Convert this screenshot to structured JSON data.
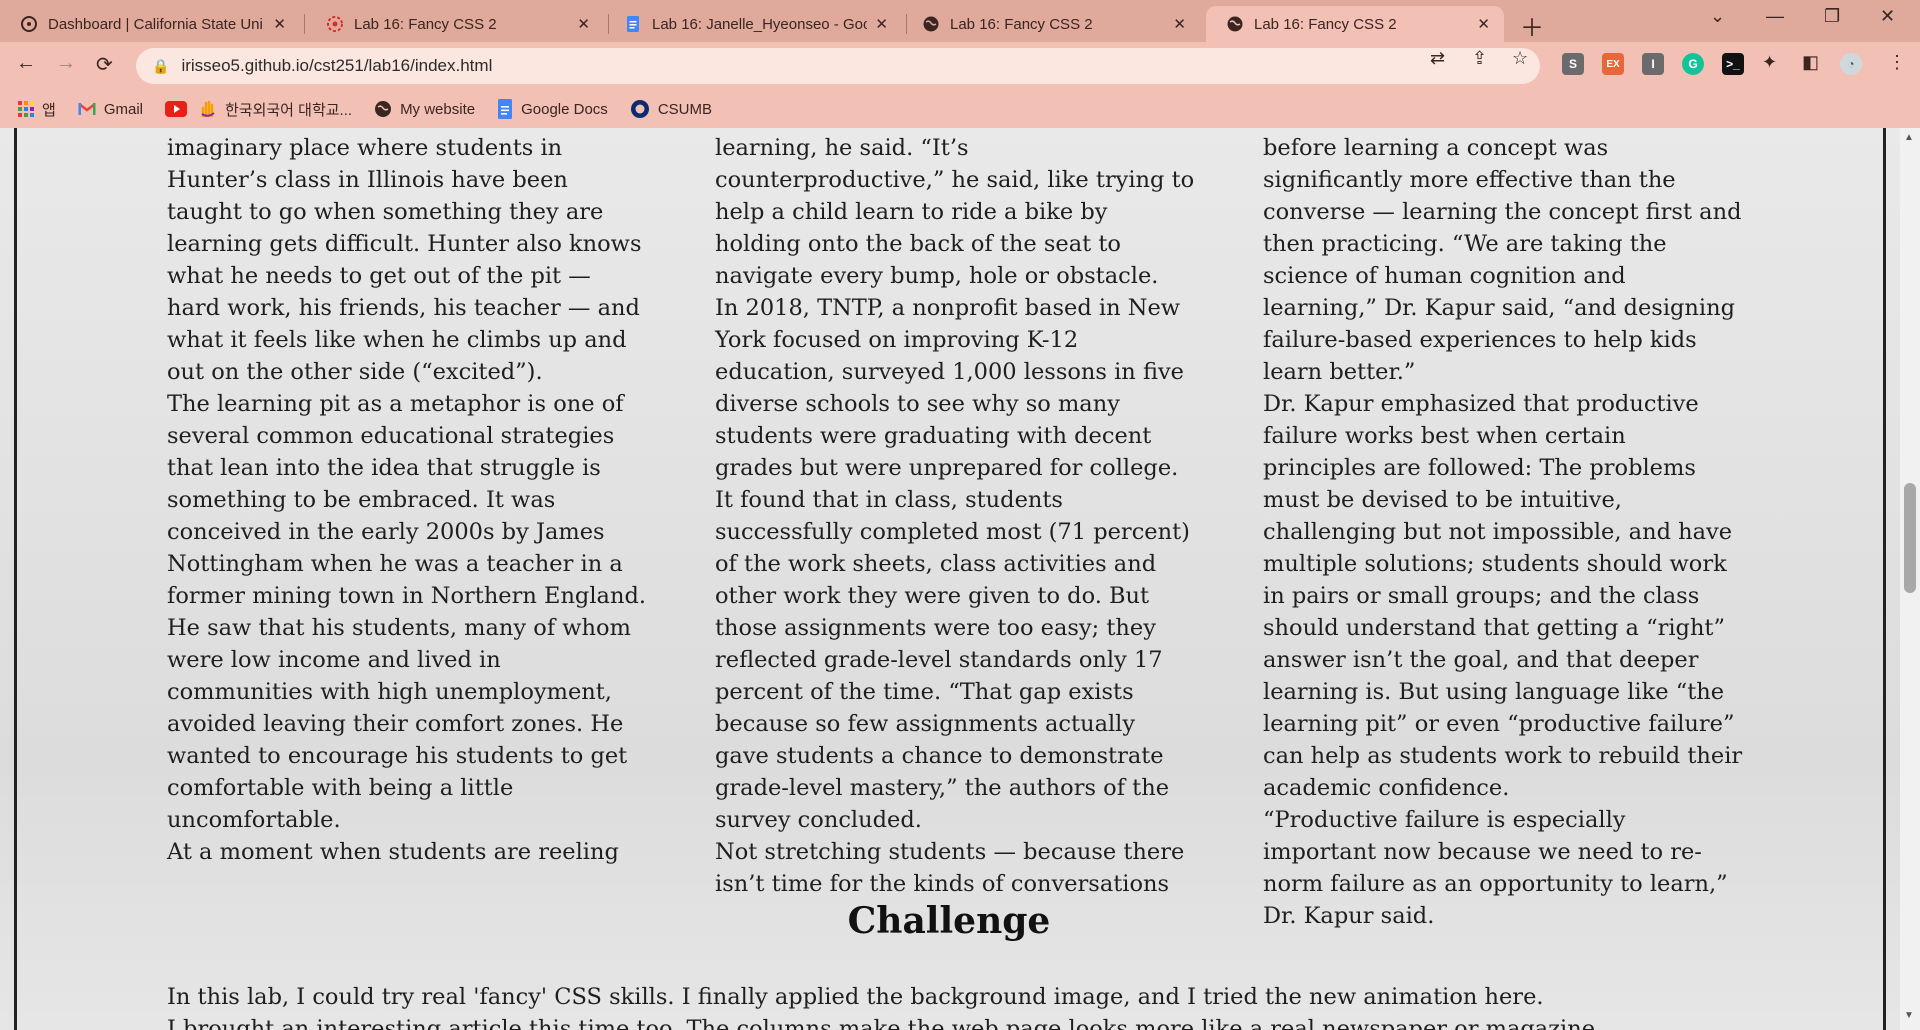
{
  "tabs": [
    {
      "title": "Dashboard | California State Uni",
      "icon": "canvas-icon"
    },
    {
      "title": "Lab 16: Fancy CSS 2",
      "icon": "red-flower-icon"
    },
    {
      "title": "Lab 16: Janelle_Hyeonseo - Goo",
      "icon": "google-docs-icon"
    },
    {
      "title": "Lab 16: Fancy CSS 2",
      "icon": "globe-icon"
    },
    {
      "title": "Lab 16: Fancy CSS 2",
      "icon": "globe-icon",
      "active": true
    }
  ],
  "address": {
    "url": "irisseo5.github.io/cst251/lab16/index.html"
  },
  "bookmarks": {
    "apps": "앱",
    "gmail": "Gmail",
    "hufs": "한국외국어 대학교...",
    "my_website": "My website",
    "google_docs": "Google Docs",
    "csumb": "CSUMB"
  },
  "extensions": {
    "s": "S",
    "ex": "EX",
    "i": "I"
  },
  "article": {
    "col1": [
      "the bottom of the learning pit, an imaginary place where students in Hunter’s class in Illinois have been taught to go when something they are learning gets difficult. Hunter also knows what he needs to get out of the pit — hard work, his friends, his teacher — and what it feels like when he climbs up and out on the other side (“excited”).",
      "The learning pit as a metaphor is one of several common educational strategies that lean into the idea that struggle is something to be embraced. It was conceived in the early 2000s by James Nottingham when he was a teacher in a former mining town in Northern England. He saw that his students, many of whom were low income and lived in communities with high unemployment, avoided leaving their comfort zones. He wanted to encourage his students to get comfortable with being a little uncomfortable.",
      "At a moment when students are reeling"
    ],
    "col2": [
      "to stretch enough to deepen their learning, he said. “It’s counterproductive,” he said, like trying to help a child learn to ride a bike by holding onto the back of the seat to navigate every bump, hole or obstacle.",
      "In 2018, TNTP, a nonprofit based in New York focused on improving K-12 education, surveyed 1,000 lessons in five diverse schools to see why so many students were graduating with decent grades but were unprepared for college. It found that in class, students successfully completed most (71 percent) of the work sheets, class activities and other work they were given to do. But those assignments were too easy; they reflected grade-level standards only 17 percent of the time. “That gap exists because so few assignments actually gave students a chance to demonstrate grade-level mastery,” the authors of the survey concluded.",
      "Not stretching students — because there isn’t time for the kinds of conversations"
    ],
    "col3": [
      "struggle first. Problem-solving practice before learning a concept was significantly more effective than the converse — learning the concept first and then practicing. “We are taking the science of human cognition and learning,” Dr. Kapur said, “and designing failure-based experiences to help kids learn better.”",
      "Dr. Kapur emphasized that productive failure works best when certain principles are followed: The problems must be devised to be intuitive, challenging but not impossible, and have multiple solutions; students should work in pairs or small groups; and the class should understand that getting a “right” answer isn’t the goal, and that deeper learning is. But using language like “the learning pit” or even “productive failure” can help as students work to rebuild their academic confidence.",
      "“Productive failure is especially important now because we need to re-norm failure as an opportunity to learn,” Dr. Kapur said."
    ]
  },
  "challenge": {
    "title": "Challenge",
    "line1": "In this lab, I could try real 'fancy' CSS skills. I finally applied the background image, and I tried the new animation here.",
    "line2": "I brought an interesting article this time too. The columns make the web page looks more like a real newspaper or magazine."
  }
}
